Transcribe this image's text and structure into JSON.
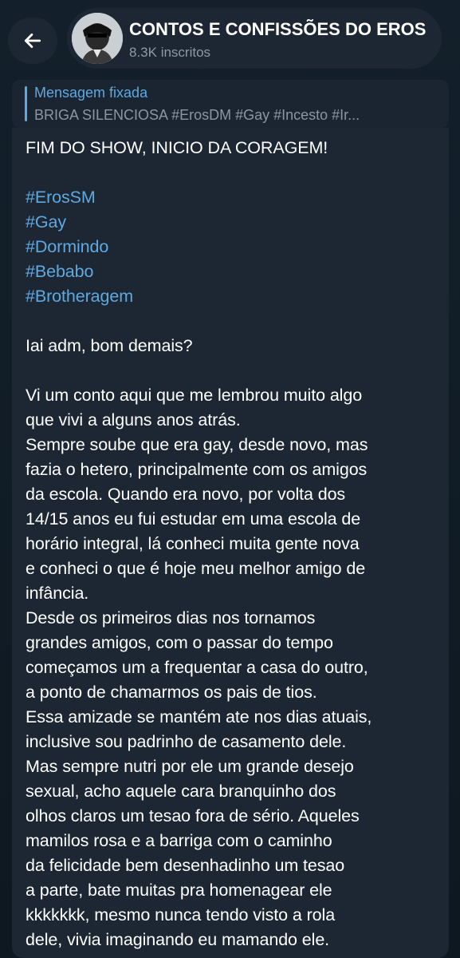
{
  "header": {
    "channel_title": "CONTOS E CONFISSÕES DO EROS",
    "subscribers": "8.3K inscritos"
  },
  "pinned": {
    "title": "Mensagem fixada",
    "preview": "BRIGA SILENCIOSA  #ErosDM #Gay #Incesto #Ir..."
  },
  "message": {
    "headline": "FIM DO SHOW, INICIO DA CORAGEM!",
    "hashtags": [
      "#ErosSM",
      "#Gay",
      "#Dormindo",
      "#Bebabo",
      "#Brotheragem"
    ],
    "greeting": "Iai adm, bom demais?",
    "body_lines": [
      "Vi um conto aqui que me lembrou muito algo",
      "que vivi a alguns anos atrás.",
      "Sempre soube que era gay, desde novo, mas",
      "fazia o hetero, principalmente com os amigos",
      "da escola. Quando era novo, por volta dos",
      "14/15 anos eu fui estudar em uma escola de",
      "horário integral, lá conheci muita gente nova",
      "e conheci o que é hoje meu melhor amigo de",
      "infância.",
      "Desde os primeiros dias nos tornamos",
      "grandes amigos, com o passar do tempo",
      "começamos um a  frequentar a casa do outro,",
      "a ponto de chamarmos os pais de tios.",
      "Essa amizade se mantém ate nos dias atuais,",
      "inclusive sou padrinho de casamento dele.",
      "Mas sempre nutri por ele um grande desejo",
      "sexual, acho aquele cara branquinho  dos",
      "olhos claros um tesao fora de sério. Aqueles",
      "mamilos rosa e a barriga com o caminho",
      "da felicidade bem desenhadinho um tesao",
      "a parte, bate muitas pra homenagear ele",
      "kkkkkkk, mesmo nunca tendo visto a rola",
      "dele, vivia imaginando eu mamando ele."
    ]
  },
  "colors": {
    "background": "#0f1a24",
    "pill": "#1c2733",
    "bubble": "#1d2733",
    "accent": "#5fa8e0",
    "muted": "#8c9aa8"
  },
  "icons": {
    "back": "arrow-left-icon",
    "avatar": "channel-avatar"
  }
}
